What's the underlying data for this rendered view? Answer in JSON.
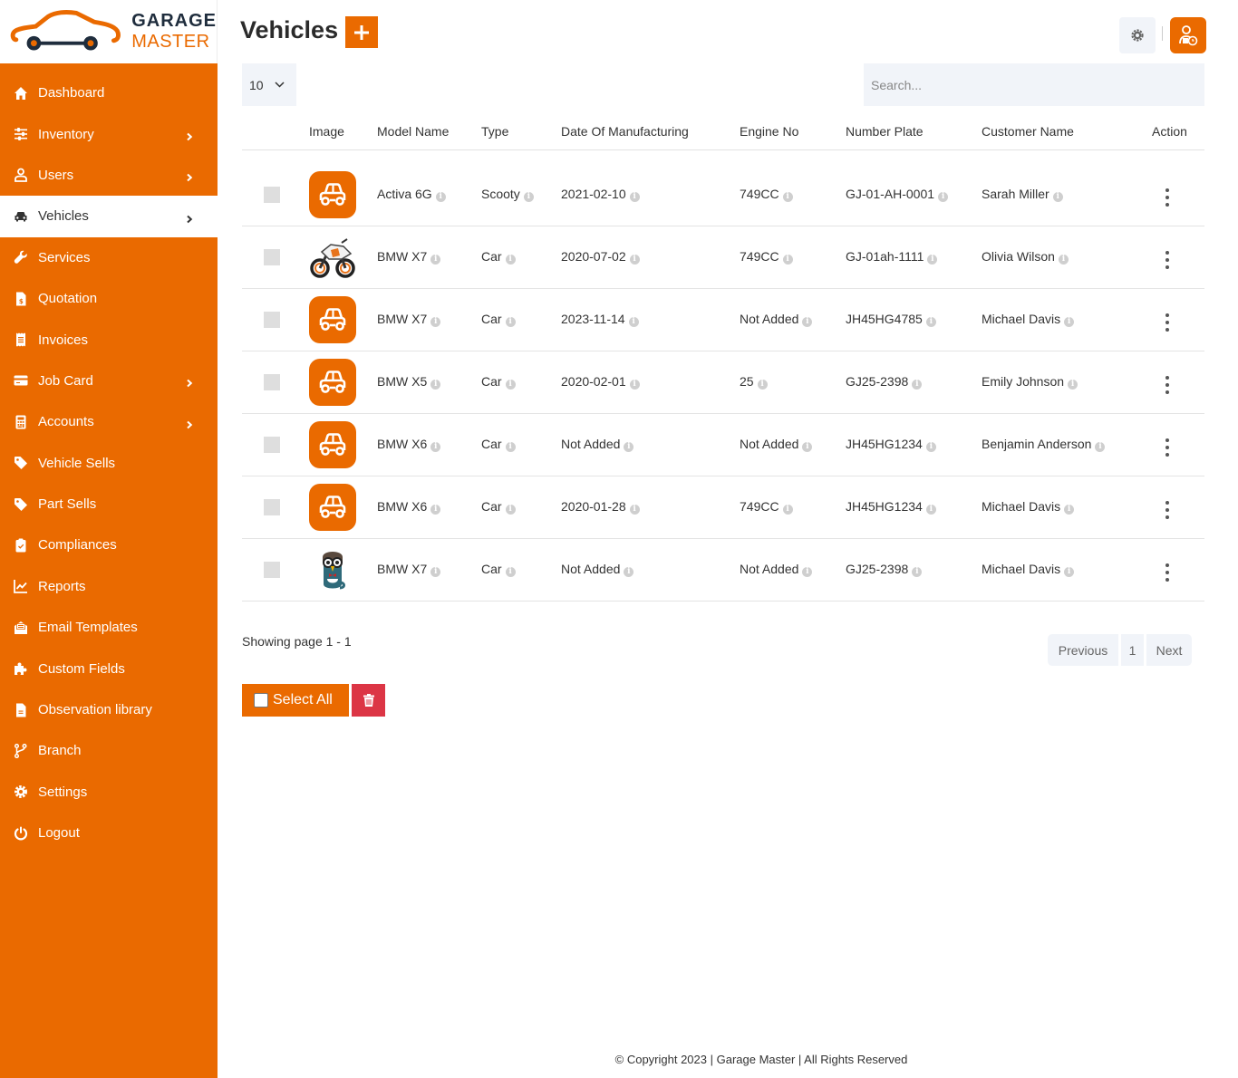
{
  "brand": {
    "line1": "GARAGE",
    "line2": "MASTER",
    "accent": "#ea6a00"
  },
  "sidebar": {
    "items": [
      {
        "label": "Dashboard",
        "icon": "home-icon",
        "chevron": false,
        "active": false
      },
      {
        "label": "Inventory",
        "icon": "sliders-icon",
        "chevron": true,
        "active": false
      },
      {
        "label": "Users",
        "icon": "user-icon",
        "chevron": true,
        "active": false
      },
      {
        "label": "Vehicles",
        "icon": "car-icon",
        "chevron": true,
        "active": true
      },
      {
        "label": "Services",
        "icon": "wrench-icon",
        "chevron": false,
        "active": false
      },
      {
        "label": "Quotation",
        "icon": "file-invoice-dollar-icon",
        "chevron": false,
        "active": false
      },
      {
        "label": "Invoices",
        "icon": "receipt-icon",
        "chevron": false,
        "active": false
      },
      {
        "label": "Job Card",
        "icon": "credit-card-icon",
        "chevron": true,
        "active": false
      },
      {
        "label": "Accounts",
        "icon": "calculator-icon",
        "chevron": true,
        "active": false
      },
      {
        "label": "Vehicle Sells",
        "icon": "tag-icon",
        "chevron": false,
        "active": false
      },
      {
        "label": "Part Sells",
        "icon": "tag-icon",
        "chevron": false,
        "active": false
      },
      {
        "label": "Compliances",
        "icon": "clipboard-check-icon",
        "chevron": false,
        "active": false
      },
      {
        "label": "Reports",
        "icon": "chart-line-icon",
        "chevron": false,
        "active": false
      },
      {
        "label": "Email Templates",
        "icon": "envelope-open-icon",
        "chevron": false,
        "active": false
      },
      {
        "label": "Custom Fields",
        "icon": "puzzle-icon",
        "chevron": false,
        "active": false
      },
      {
        "label": "Observation library",
        "icon": "file-icon",
        "chevron": false,
        "active": false
      },
      {
        "label": "Branch",
        "icon": "code-branch-icon",
        "chevron": false,
        "active": false
      },
      {
        "label": "Settings",
        "icon": "gear-icon",
        "chevron": false,
        "active": false
      },
      {
        "label": "Logout",
        "icon": "power-icon",
        "chevron": false,
        "active": false
      }
    ]
  },
  "header": {
    "title": "Vehicles",
    "add_label": "+"
  },
  "controls": {
    "page_length": "10",
    "search_placeholder": "Search...",
    "search_value": ""
  },
  "table": {
    "columns": [
      "",
      "Image",
      "Model Name",
      "Type",
      "Date Of Manufacturing",
      "Engine No",
      "Number Plate",
      "Customer Name",
      "Action"
    ],
    "rows": [
      {
        "image": "car-placeholder",
        "model": "Activa 6G",
        "type": "Scooty",
        "date": "2021-02-10",
        "engine": "749CC",
        "plate": "GJ-01-AH-0001",
        "customer": "Sarah Miller"
      },
      {
        "image": "motorcycle-photo",
        "model": "BMW X7",
        "type": "Car",
        "date": "2020-07-02",
        "engine": "749CC",
        "plate": "GJ-01ah-1111",
        "customer": "Olivia Wilson"
      },
      {
        "image": "car-placeholder",
        "model": "BMW X7",
        "type": "Car",
        "date": "2023-11-14",
        "engine": "Not Added",
        "plate": "JH45HG4785",
        "customer": "Michael Davis"
      },
      {
        "image": "car-placeholder",
        "model": "BMW X5",
        "type": "Car",
        "date": "2020-02-01",
        "engine": "25",
        "plate": "GJ25-2398",
        "customer": "Emily Johnson"
      },
      {
        "image": "car-placeholder",
        "model": "BMW X6",
        "type": "Car",
        "date": "Not Added",
        "engine": "Not Added",
        "plate": "JH45HG1234",
        "customer": "Benjamin Anderson"
      },
      {
        "image": "car-placeholder",
        "model": "BMW X6",
        "type": "Car",
        "date": "2020-01-28",
        "engine": "749CC",
        "plate": "JH45HG1234",
        "customer": "Michael Davis"
      },
      {
        "image": "owl-avatar-photo",
        "model": "BMW X7",
        "type": "Car",
        "date": "Not Added",
        "engine": "Not Added",
        "plate": "GJ25-2398",
        "customer": "Michael Davis"
      }
    ]
  },
  "pagination": {
    "showing": "Showing page 1 - 1",
    "previous": "Previous",
    "current": "1",
    "next": "Next"
  },
  "bulk": {
    "select_all": "Select All"
  },
  "footer": {
    "text": "© Copyright 2023 | Garage Master | All Rights Reserved"
  }
}
